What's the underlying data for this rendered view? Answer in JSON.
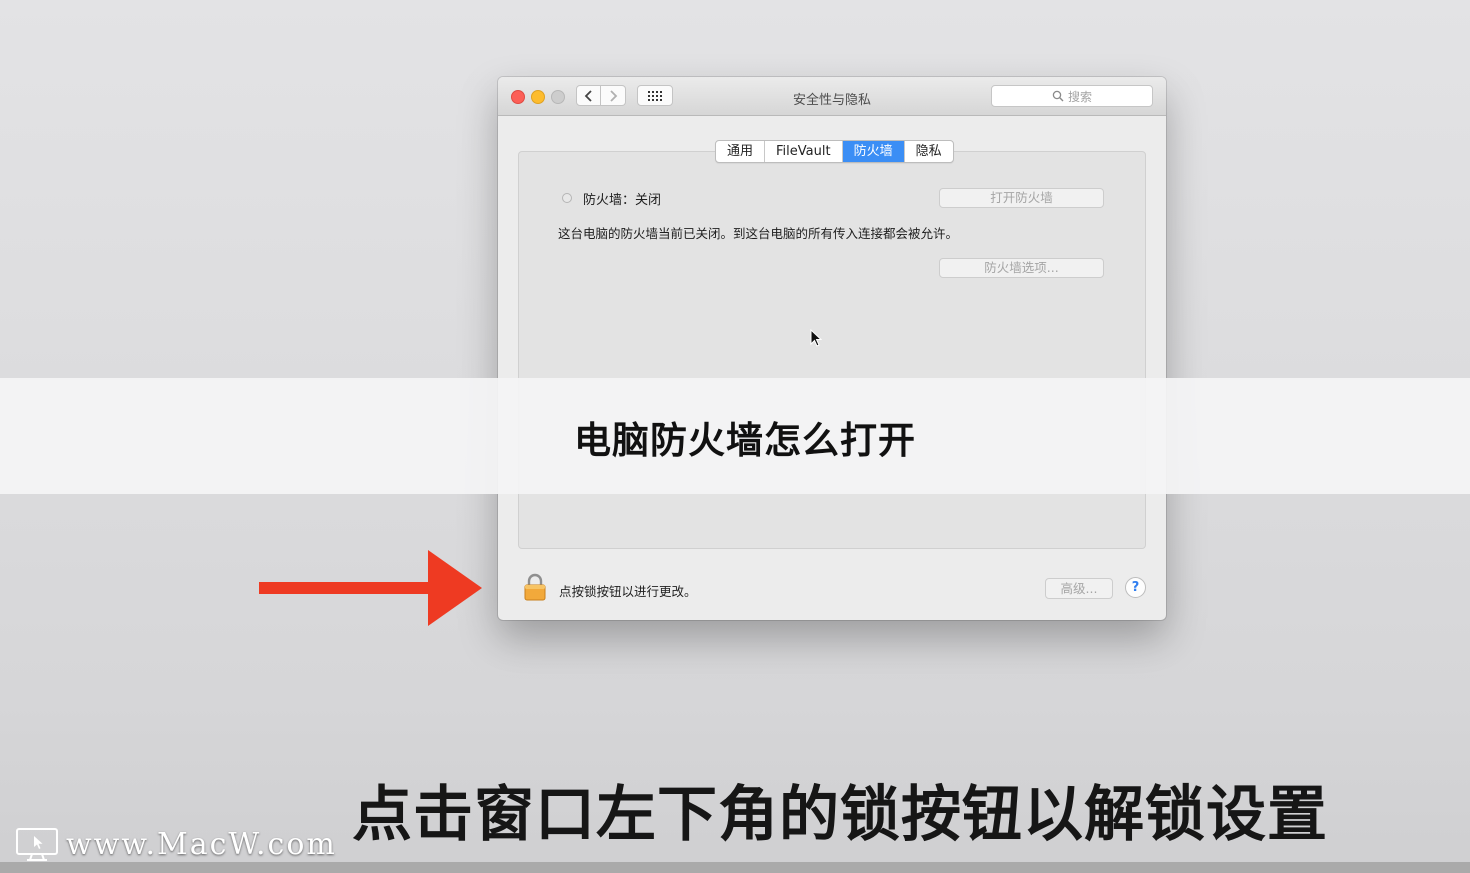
{
  "window": {
    "title": "安全性与隐私",
    "search_placeholder": "搜索",
    "tabs": [
      {
        "label": "通用",
        "active": false
      },
      {
        "label": "FileVault",
        "active": false
      },
      {
        "label": "防火墙",
        "active": true
      },
      {
        "label": "隐私",
        "active": false
      }
    ],
    "firewall": {
      "status_label": "防火墙：关闭",
      "description": "这台电脑的防火墙当前已关闭。到这台电脑的所有传入连接都会被允许。",
      "turn_on_button": "打开防火墙",
      "options_button": "防火墙选项..."
    },
    "lock_text": "点按锁按钮以进行更改。",
    "advanced_button": "高级...",
    "help_button": "?"
  },
  "overlay": {
    "banner_title": "电脑防火墙怎么打开",
    "subtitle": "点击窗口左下角的锁按钮以解锁设置",
    "watermark": "www.MacW.com"
  },
  "colors": {
    "tab_active": "#3b8ef5",
    "arrow": "#ee3a22",
    "close": "#fc5f57",
    "minimize": "#fdbc2e"
  },
  "icons": [
    "back-icon",
    "forward-icon",
    "grid-icon",
    "search-icon",
    "lock-icon",
    "help-icon",
    "arrow-icon",
    "monitor-icon",
    "cursor-icon"
  ]
}
